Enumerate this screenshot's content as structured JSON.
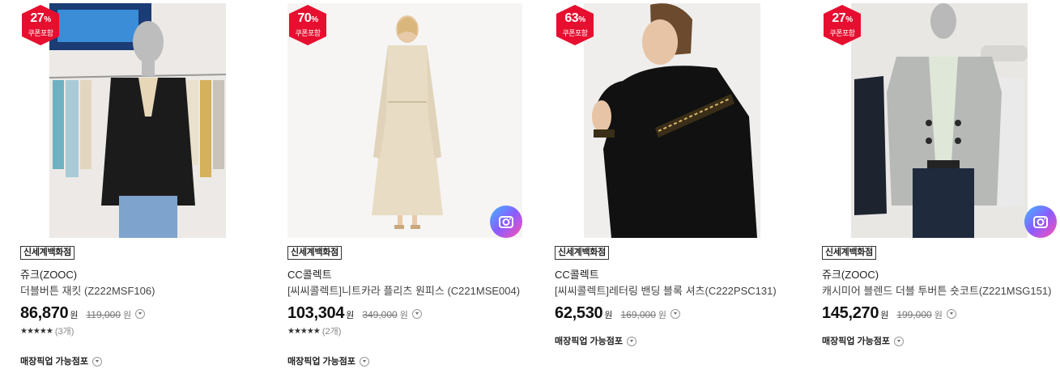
{
  "products": [
    {
      "discount": "27",
      "percent_sign": "%",
      "coupon": "쿠폰포함",
      "store": "신세계백화점",
      "brand": "쥬크(ZOOC)",
      "name": "더블버튼 재킷 (Z222MSF106)",
      "price": "86,870",
      "currency": "원",
      "original_price": "119,000",
      "original_currency": "원",
      "stars": "★★★★★",
      "review_count": "(3개)",
      "pickup": "매장픽업 가능점포",
      "camera_icon": false
    },
    {
      "discount": "70",
      "percent_sign": "%",
      "coupon": "쿠폰포함",
      "store": "신세계백화점",
      "brand": "CC콜렉트",
      "name": "[씨씨콜렉트]니트카라 플리츠 원피스 (C221MSE004)",
      "price": "103,304",
      "currency": "원",
      "original_price": "349,000",
      "original_currency": "원",
      "stars": "★★★★★",
      "review_count": "(2개)",
      "pickup": "매장픽업 가능점포",
      "camera_icon": true
    },
    {
      "discount": "63",
      "percent_sign": "%",
      "coupon": "쿠폰포함",
      "store": "신세계백화점",
      "brand": "CC콜렉트",
      "name": "[씨씨콜렉트]레터링 밴딩 블록 셔츠(C222PSC131)",
      "price": "62,530",
      "currency": "원",
      "original_price": "169,000",
      "original_currency": "원",
      "pickup": "매장픽업 가능점포",
      "camera_icon": false
    },
    {
      "discount": "27",
      "percent_sign": "%",
      "coupon": "쿠폰포함",
      "store": "신세계백화점",
      "brand": "쥬크(ZOOC)",
      "name": "캐시미어 블렌드 더블 투버튼 숏코트(Z221MSG151)",
      "price": "145,270",
      "currency": "원",
      "original_price": "199,000",
      "original_currency": "원",
      "pickup": "매장픽업 가능점포",
      "camera_icon": true
    }
  ],
  "colors": {
    "badge": "#e60f2f",
    "price": "#111111",
    "original_price": "#777777"
  }
}
